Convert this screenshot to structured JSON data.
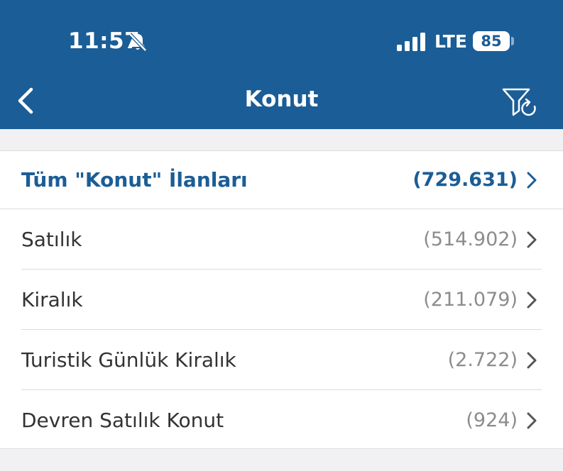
{
  "status_bar": {
    "time": "11:57",
    "network": "LTE",
    "battery": "85"
  },
  "nav": {
    "title": "Konut"
  },
  "list": {
    "items": [
      {
        "label": "Tüm \"Konut\" İlanları",
        "count": "(729.631)"
      },
      {
        "label": "Satılık",
        "count": "(514.902)"
      },
      {
        "label": "Kiralık",
        "count": "(211.079)"
      },
      {
        "label": "Turistik Günlük Kiralık",
        "count": "(2.722)"
      },
      {
        "label": "Devren Satılık Konut",
        "count": "(924)"
      }
    ]
  },
  "colors": {
    "header_bg": "#1b5d96",
    "accent": "#1b5d96",
    "count_gray": "#8c8c8c"
  }
}
